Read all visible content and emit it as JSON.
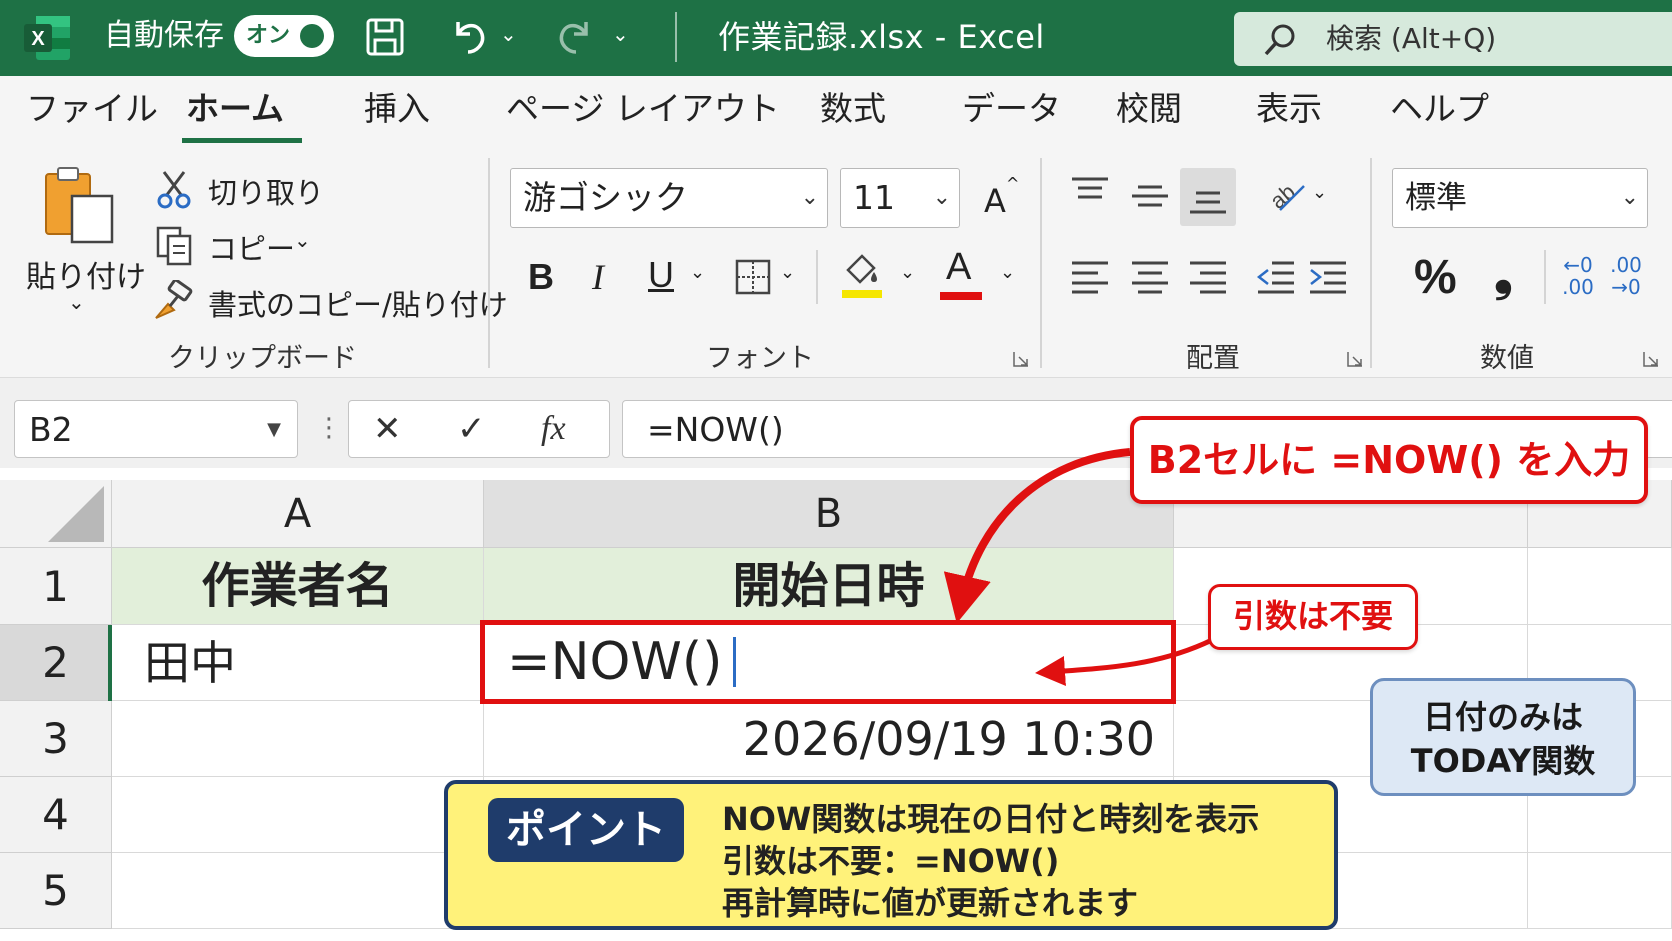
{
  "titlebar": {
    "app_letter": "X",
    "autosave_label": "自動保存",
    "autosave_toggle": "オン",
    "document_title": "作業記録.xlsx  -  Excel",
    "search_placeholder": "検索 (Alt+Q)"
  },
  "tabs": [
    {
      "label": "ファイル"
    },
    {
      "label": "ホーム",
      "active": true
    },
    {
      "label": "挿入"
    },
    {
      "label": "ページ レイアウト"
    },
    {
      "label": "数式"
    },
    {
      "label": "データ"
    },
    {
      "label": "校閲"
    },
    {
      "label": "表示"
    },
    {
      "label": "ヘルプ"
    }
  ],
  "ribbon": {
    "clipboard": {
      "paste": "貼り付け",
      "cut": "切り取り",
      "copy": "コピー",
      "format_painter": "書式のコピー/貼り付け",
      "group": "クリップボード"
    },
    "font": {
      "font_name": "游ゴシック",
      "font_size": "11",
      "grow": "A",
      "bold": "B",
      "italic": "I",
      "underline": "U",
      "font_color": "A",
      "group": "フォント",
      "fill_color": "#f5e600",
      "text_color": "#e01010"
    },
    "alignment": {
      "group": "配置"
    },
    "number": {
      "format": "標準",
      "percent": "%",
      "comma": "❟",
      "dec_increase": "←0 .00",
      "dec_decrease": ".00 →0",
      "group": "数値"
    }
  },
  "formula_bar": {
    "name_box": "B2",
    "cancel": "✕",
    "enter": "✓",
    "fx": "fx",
    "formula": "=NOW()"
  },
  "sheet": {
    "columns": [
      "A",
      "B"
    ],
    "rows": [
      "1",
      "2",
      "3",
      "4",
      "5"
    ],
    "cells": {
      "A1": "作業者名",
      "B1": "開始日時",
      "A2": "田中",
      "B2": "=NOW()",
      "B3": "2026/09/19 10:30"
    },
    "header_fill": "#e2efda",
    "active_cell": "B2"
  },
  "annotations": {
    "callout_main": "B2セルに =NOW() を入力",
    "callout_args": "引数は不要",
    "info_today_line1": "日付のみは",
    "info_today_line2": "TODAY関数",
    "point_badge": "ポイント",
    "point_lines": [
      "NOW関数は現在の日付と時刻を表示",
      "引数は不要：=NOW()",
      "再計算時に値が更新されます"
    ],
    "accent_red": "#e01010",
    "accent_navy": "#1f3c6b",
    "accent_yellow": "#fff27a"
  }
}
